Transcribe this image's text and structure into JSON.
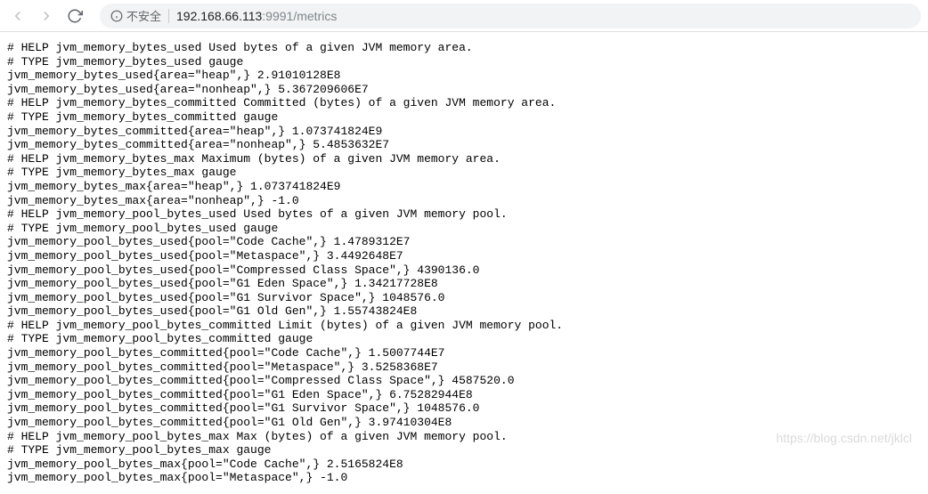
{
  "toolbar": {
    "security_label": "不安全",
    "url_host": "192.168.66.113",
    "url_port": ":9991",
    "url_path": "/metrics"
  },
  "metrics": {
    "lines": [
      "# HELP jvm_memory_bytes_used Used bytes of a given JVM memory area.",
      "# TYPE jvm_memory_bytes_used gauge",
      "jvm_memory_bytes_used{area=\"heap\",} 2.91010128E8",
      "jvm_memory_bytes_used{area=\"nonheap\",} 5.367209606E7",
      "# HELP jvm_memory_bytes_committed Committed (bytes) of a given JVM memory area.",
      "# TYPE jvm_memory_bytes_committed gauge",
      "jvm_memory_bytes_committed{area=\"heap\",} 1.073741824E9",
      "jvm_memory_bytes_committed{area=\"nonheap\",} 5.4853632E7",
      "# HELP jvm_memory_bytes_max Maximum (bytes) of a given JVM memory area.",
      "# TYPE jvm_memory_bytes_max gauge",
      "jvm_memory_bytes_max{area=\"heap\",} 1.073741824E9",
      "jvm_memory_bytes_max{area=\"nonheap\",} -1.0",
      "# HELP jvm_memory_pool_bytes_used Used bytes of a given JVM memory pool.",
      "# TYPE jvm_memory_pool_bytes_used gauge",
      "jvm_memory_pool_bytes_used{pool=\"Code Cache\",} 1.4789312E7",
      "jvm_memory_pool_bytes_used{pool=\"Metaspace\",} 3.4492648E7",
      "jvm_memory_pool_bytes_used{pool=\"Compressed Class Space\",} 4390136.0",
      "jvm_memory_pool_bytes_used{pool=\"G1 Eden Space\",} 1.34217728E8",
      "jvm_memory_pool_bytes_used{pool=\"G1 Survivor Space\",} 1048576.0",
      "jvm_memory_pool_bytes_used{pool=\"G1 Old Gen\",} 1.55743824E8",
      "# HELP jvm_memory_pool_bytes_committed Limit (bytes) of a given JVM memory pool.",
      "# TYPE jvm_memory_pool_bytes_committed gauge",
      "jvm_memory_pool_bytes_committed{pool=\"Code Cache\",} 1.5007744E7",
      "jvm_memory_pool_bytes_committed{pool=\"Metaspace\",} 3.5258368E7",
      "jvm_memory_pool_bytes_committed{pool=\"Compressed Class Space\",} 4587520.0",
      "jvm_memory_pool_bytes_committed{pool=\"G1 Eden Space\",} 6.75282944E8",
      "jvm_memory_pool_bytes_committed{pool=\"G1 Survivor Space\",} 1048576.0",
      "jvm_memory_pool_bytes_committed{pool=\"G1 Old Gen\",} 3.97410304E8",
      "# HELP jvm_memory_pool_bytes_max Max (bytes) of a given JVM memory pool.",
      "# TYPE jvm_memory_pool_bytes_max gauge",
      "jvm_memory_pool_bytes_max{pool=\"Code Cache\",} 2.5165824E8",
      "jvm_memory_pool_bytes_max{pool=\"Metaspace\",} -1.0"
    ]
  },
  "watermark": "https://blog.csdn.net/jklcl"
}
